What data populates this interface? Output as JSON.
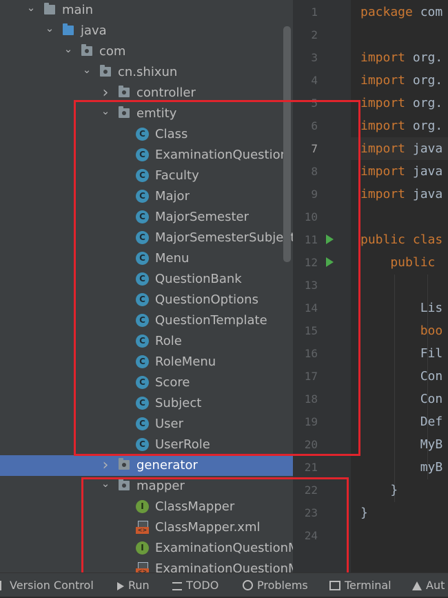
{
  "tree": {
    "items": [
      {
        "label": "main",
        "depth": 1,
        "expanded": true,
        "icon": "folder-icon",
        "kind": "folder",
        "selected": false
      },
      {
        "label": "java",
        "depth": 2,
        "expanded": true,
        "icon": "source-folder-icon",
        "kind": "folder-blue",
        "selected": false
      },
      {
        "label": "com",
        "depth": 3,
        "expanded": true,
        "icon": "package-icon",
        "kind": "package",
        "selected": false
      },
      {
        "label": "cn.shixun",
        "depth": 4,
        "expanded": true,
        "icon": "package-icon",
        "kind": "package",
        "selected": false
      },
      {
        "label": "controller",
        "depth": 5,
        "expanded": false,
        "icon": "package-icon",
        "kind": "package",
        "selected": false
      },
      {
        "label": "emtity",
        "depth": 5,
        "expanded": true,
        "icon": "package-icon",
        "kind": "package",
        "selected": false
      },
      {
        "label": "Class",
        "depth": 6,
        "icon": "class-icon",
        "kind": "class",
        "selected": false
      },
      {
        "label": "ExaminationQuestion",
        "depth": 6,
        "icon": "class-icon",
        "kind": "class",
        "selected": false
      },
      {
        "label": "Faculty",
        "depth": 6,
        "icon": "class-icon",
        "kind": "class",
        "selected": false
      },
      {
        "label": "Major",
        "depth": 6,
        "icon": "class-icon",
        "kind": "class",
        "selected": false
      },
      {
        "label": "MajorSemester",
        "depth": 6,
        "icon": "class-icon",
        "kind": "class",
        "selected": false
      },
      {
        "label": "MajorSemesterSubject",
        "depth": 6,
        "icon": "class-icon",
        "kind": "class",
        "selected": false
      },
      {
        "label": "Menu",
        "depth": 6,
        "icon": "class-icon",
        "kind": "class",
        "selected": false
      },
      {
        "label": "QuestionBank",
        "depth": 6,
        "icon": "class-icon",
        "kind": "class",
        "selected": false
      },
      {
        "label": "QuestionOptions",
        "depth": 6,
        "icon": "class-icon",
        "kind": "class",
        "selected": false
      },
      {
        "label": "QuestionTemplate",
        "depth": 6,
        "icon": "class-icon",
        "kind": "class",
        "selected": false
      },
      {
        "label": "Role",
        "depth": 6,
        "icon": "class-icon",
        "kind": "class",
        "selected": false
      },
      {
        "label": "RoleMenu",
        "depth": 6,
        "icon": "class-icon",
        "kind": "class",
        "selected": false
      },
      {
        "label": "Score",
        "depth": 6,
        "icon": "class-icon",
        "kind": "class",
        "selected": false
      },
      {
        "label": "Subject",
        "depth": 6,
        "icon": "class-icon",
        "kind": "class",
        "selected": false
      },
      {
        "label": "User",
        "depth": 6,
        "icon": "class-icon",
        "kind": "class",
        "selected": false
      },
      {
        "label": "UserRole",
        "depth": 6,
        "icon": "class-icon",
        "kind": "class",
        "selected": false
      },
      {
        "label": "generator",
        "depth": 5,
        "expanded": false,
        "icon": "package-icon",
        "kind": "package",
        "selected": true
      },
      {
        "label": "mapper",
        "depth": 5,
        "expanded": true,
        "icon": "package-icon",
        "kind": "package",
        "selected": false
      },
      {
        "label": "ClassMapper",
        "depth": 6,
        "icon": "interface-icon",
        "kind": "interface",
        "selected": false
      },
      {
        "label": "ClassMapper.xml",
        "depth": 6,
        "icon": "xml-file-icon",
        "kind": "xml",
        "selected": false
      },
      {
        "label": "ExaminationQuestionMapper",
        "depth": 6,
        "icon": "interface-icon",
        "kind": "interface",
        "selected": false
      },
      {
        "label": "ExaminationQuestionMapper.xml",
        "depth": 6,
        "icon": "xml-file-icon",
        "kind": "xml",
        "selected": false
      }
    ]
  },
  "editor": {
    "current_line": 7,
    "lines": [
      {
        "n": "1",
        "kw": "package",
        "rest": " com"
      },
      {
        "n": "2",
        "kw": "",
        "rest": ""
      },
      {
        "n": "3",
        "kw": "import",
        "rest": " org."
      },
      {
        "n": "4",
        "kw": "import",
        "rest": " org."
      },
      {
        "n": "5",
        "kw": "import",
        "rest": " org."
      },
      {
        "n": "6",
        "kw": "import",
        "rest": " org."
      },
      {
        "n": "7",
        "kw": "import",
        "rest": " java"
      },
      {
        "n": "8",
        "kw": "import",
        "rest": " java"
      },
      {
        "n": "9",
        "kw": "import",
        "rest": " java"
      },
      {
        "n": "10",
        "kw": "",
        "rest": ""
      },
      {
        "n": "11",
        "kw": "public clas",
        "rest": ""
      },
      {
        "n": "12",
        "kw": "    public ",
        "rest": ""
      },
      {
        "n": "13",
        "kw": "",
        "rest": ""
      },
      {
        "n": "14",
        "kw": "",
        "rest": "        Lis"
      },
      {
        "n": "15",
        "kw": "        boo",
        "rest": ""
      },
      {
        "n": "16",
        "kw": "",
        "rest": "        Fil"
      },
      {
        "n": "17",
        "kw": "",
        "rest": "        Con"
      },
      {
        "n": "18",
        "kw": "",
        "rest": "        Con"
      },
      {
        "n": "19",
        "kw": "",
        "rest": "        Def"
      },
      {
        "n": "20",
        "kw": "",
        "rest": "        MyB"
      },
      {
        "n": "21",
        "kw": "",
        "rest": "        myB"
      },
      {
        "n": "22",
        "kw": "",
        "rest": "    }"
      },
      {
        "n": "23",
        "kw": "",
        "rest": "}"
      },
      {
        "n": "24",
        "kw": "",
        "rest": ""
      }
    ],
    "run_marker_lines": [
      11,
      12
    ],
    "fold_marker_lines": [
      3,
      9,
      12,
      22
    ]
  },
  "bottom_bar": {
    "items": [
      {
        "label": "Version Control",
        "icon": "branch-icon"
      },
      {
        "label": "Run",
        "icon": "run-icon"
      },
      {
        "label": "TODO",
        "icon": "list-icon"
      },
      {
        "label": "Problems",
        "icon": "warning-icon"
      },
      {
        "label": "Terminal",
        "icon": "terminal-icon"
      },
      {
        "label": "Aut",
        "icon": "warning-triangle-icon"
      }
    ]
  },
  "colors": {
    "highlight_box": "#e0242c",
    "selection": "#4b6eaf",
    "keyword": "#cc7832",
    "class_icon": "#3d8fb5",
    "interface_icon": "#6a9a3c"
  }
}
